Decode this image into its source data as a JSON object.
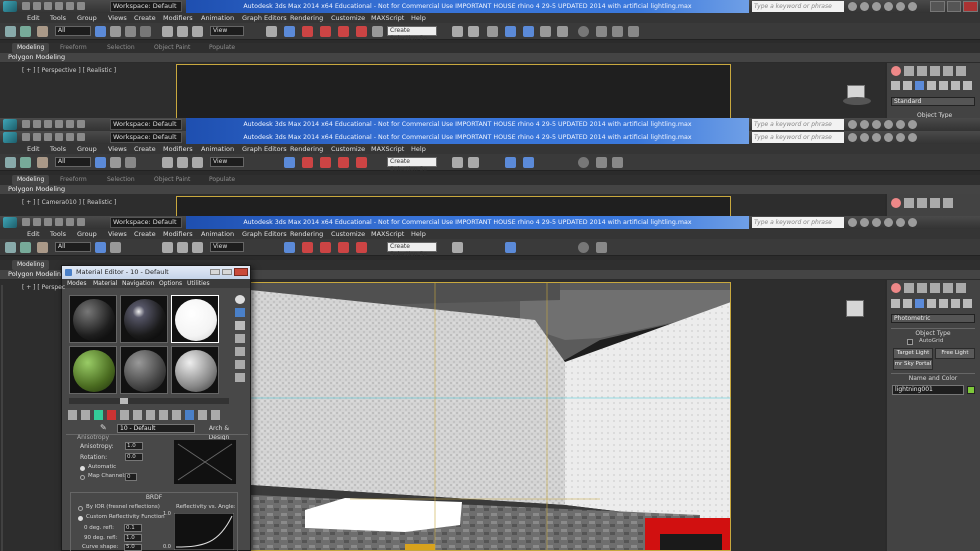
{
  "app": {
    "workspace": "Workspace: Default",
    "title": "Autodesk 3ds Max  2014 x64    Educational - Not for Commercial Use    IMPORTANT HOUSE rhino 4 29-5 UPDATED 2014 with artificial lightling.max",
    "search_placeholder": "Type a keyword or phrase"
  },
  "menu": {
    "items": [
      "Edit",
      "Tools",
      "Group",
      "Views",
      "Create",
      "Modifiers",
      "Animation",
      "Graph Editors",
      "Rendering",
      "Customize",
      "MAXScript",
      "Help"
    ]
  },
  "toolbar": {
    "filter": "All",
    "ref_coord": "View",
    "selection_set": "Create Selection Se"
  },
  "ribbon": {
    "tabs": [
      "Modeling",
      "Freeform",
      "Selection",
      "Object Paint",
      "Populate"
    ],
    "panel_label": "Polygon Modeling"
  },
  "viewports": {
    "top_label": "[ + ] [ Perspective ] [ Realistic ]",
    "mid_label": "[ + ] [ Camera010 ] [ Realistic ]",
    "main_label": "[ + ] [ Perspec"
  },
  "command_panel": {
    "top_dropdown": "Standard",
    "top_rollout": "Object Type",
    "dropdown": "Photometric",
    "object_type_header": "Object Type",
    "autogrid": "AutoGrid",
    "target_light": "Target Light",
    "free_light": "Free Light",
    "mr_sky_portal": "mr Sky Portal",
    "name_color_header": "Name and Color",
    "object_name": "lightning001",
    "object_color": "#7ec83a"
  },
  "material_editor": {
    "title": "Material Editor - 10 - Default",
    "menu": [
      "Modes",
      "Material",
      "Navigation",
      "Options",
      "Utilities"
    ],
    "material_name": "10 - Default",
    "material_type": "Arch & Design",
    "anisotropy": {
      "header": "Anisotropy",
      "anisotropy_label": "Anisotropy:",
      "anisotropy_value": "1.0",
      "rotation_label": "Rotation:",
      "rotation_value": "0.0",
      "automatic": "Automatic",
      "map_channel_label": "Map Channel:",
      "map_channel_value": "0"
    },
    "brdf": {
      "header": "BRDF",
      "by_ior": "By IOR (fresnel reflections)",
      "custom": "Custom Reflectivity Function",
      "deg0_label": "0 deg. refl:",
      "deg0_value": "0.1",
      "deg90_label": "90 deg. refl:",
      "deg90_value": "1.0",
      "curve_label": "Curve shape:",
      "curve_value": "5.0",
      "graph_title": "Reflectivity vs. Angle:",
      "graph_y_max": "1.0",
      "graph_y_min": "0.0"
    }
  }
}
